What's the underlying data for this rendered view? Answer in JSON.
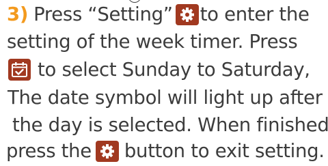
{
  "instruction": {
    "step_number": "3)",
    "line1_before_icon": "Press “Setting”",
    "line1_after_icon": "to enter the",
    "line2": "setting of the week timer. Press",
    "line3_after_icon": "to select Sunday to Saturday,",
    "line4": "The date symbol will light up after",
    "line5": "the day is selected. When finished,",
    "line6_before_icon": "press the",
    "line6_after_icon": "button to exit setting."
  },
  "icons": {
    "setting_icon": "gear-icon",
    "calendar_icon": "calendar-check-icon",
    "icon_background_color": "#a13920",
    "icon_foreground_color": "#ffffff"
  },
  "colors": {
    "step_number_color": "#f39a1e",
    "text_color": "#3c3c3c"
  }
}
